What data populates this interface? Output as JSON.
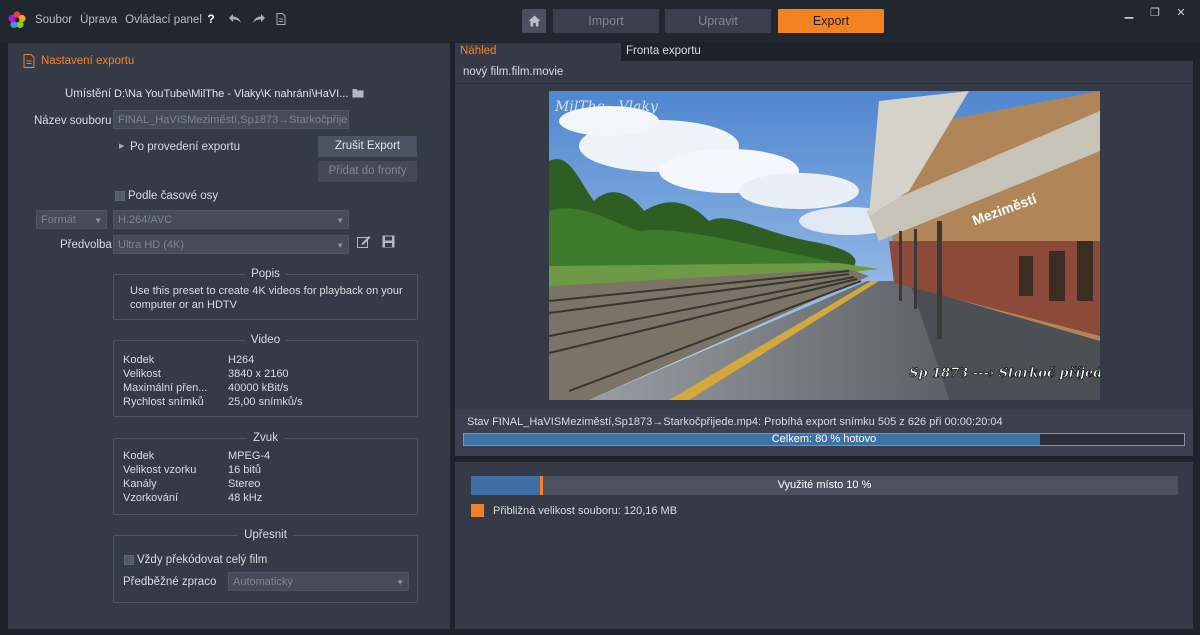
{
  "menu": {
    "file": "Soubor",
    "edit": "Úprava",
    "control_panel": "Ovládací panel",
    "help": "?"
  },
  "modes": {
    "import": "Import",
    "edit": "Upravit",
    "export": "Export"
  },
  "left": {
    "section_title": "Nastavení exportu",
    "location_label": "Umístění",
    "location_value": "D:\\Na YouTube\\MilThe - Vlaky\\K nahrání\\HaVI...",
    "filename_label": "Název souboru",
    "filename_value": "FINAL_HaVISMeziměstí,Sp1873→Starkočpřijed",
    "after_export_label": "Po provedení exportu",
    "cancel_export": "Zrušit Export",
    "add_to_queue": "Přidat do fronty",
    "timeline_label": "Podle časové osy",
    "format_label": "Formát",
    "format_value": "H.264/AVC",
    "preset_label": "Předvolba",
    "preset_value": "Ultra HD (4K)",
    "description_title": "Popis",
    "description_text": "Use this preset to create 4K videos for playback on your computer or an HDTV",
    "video_title": "Video",
    "video_rows": [
      {
        "key": "Kodek",
        "value": "H264"
      },
      {
        "key": "Velikost",
        "value": "3840 x 2160"
      },
      {
        "key": "Maximální přen...",
        "value": "40000 kBit/s"
      },
      {
        "key": "Rychlost snímků",
        "value": "25,00 snímků/s"
      }
    ],
    "audio_title": "Zvuk",
    "audio_rows": [
      {
        "key": "Kodek",
        "value": "MPEG-4"
      },
      {
        "key": "Velikost vzorku",
        "value": "16 bitů"
      },
      {
        "key": "Kanály",
        "value": "Stereo"
      },
      {
        "key": "Vzorkování",
        "value": "48 kHz"
      }
    ],
    "refine_title": "Upřesnit",
    "always_reencode": "Vždy překódovat celý film",
    "prerender_label": "Předběžné zpraco",
    "prerender_value": "Automatický"
  },
  "right": {
    "tab_preview": "Náhled",
    "tab_queue": "Fronta exportu",
    "movie_name": "nový film.film.movie",
    "watermark_top": "MilThe - Vlaky",
    "watermark_bottom": "Sp 1873 ---› Starkoč příjede.",
    "station_sign": "Meziměstí",
    "status_text": "Stav FINAL_HaVISMeziměstí,Sp1873→Starkočpřijede.mp4: Probíhá export snímku 505 z 626 při 00:00:20:04",
    "total_progress_label": "Celkem: 80 % hotovo",
    "total_progress": 0.8,
    "space_label": "Využité místo 10 %",
    "space_used": 0.1,
    "file_size_label": "Přibližná velikost souboru: 120,16 MB"
  },
  "colors": {
    "accent": "#f58220",
    "progress": "#3c72a4",
    "panel": "#343a46",
    "background": "#1e222b"
  }
}
